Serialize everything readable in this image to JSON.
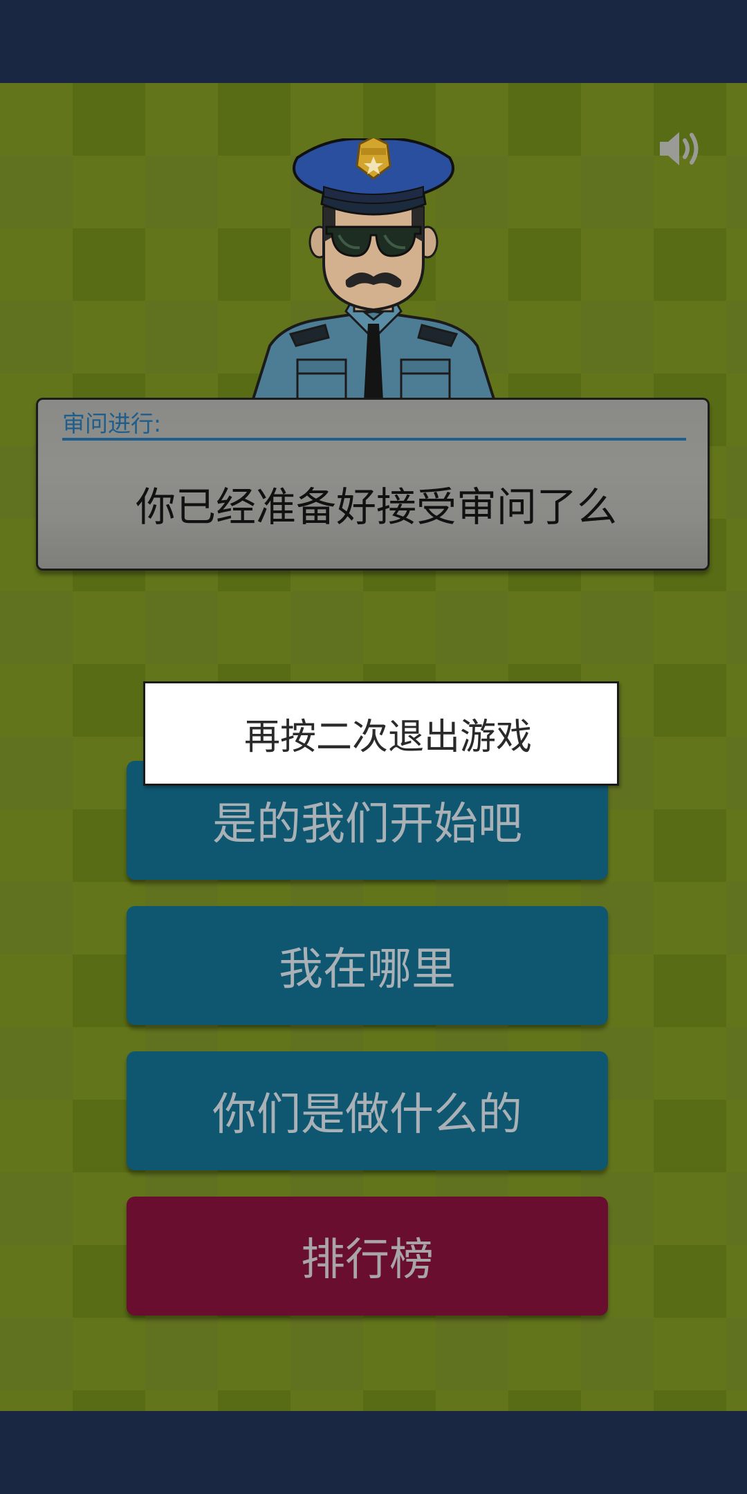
{
  "panel": {
    "label": "审问进行:",
    "question": "你已经准备好接受审问了么"
  },
  "buttons": [
    {
      "label": "是的我们开始吧"
    },
    {
      "label": "我在哪里"
    },
    {
      "label": "你们是做什么的"
    },
    {
      "label": "排行榜"
    }
  ],
  "toast": {
    "message": "再按二次退出游戏"
  },
  "icons": {
    "sound": "speaker-volume-icon",
    "character": "police-officer-icon"
  },
  "colors": {
    "background": "#5e7216",
    "system_bars": "#1a2742",
    "button_blue": "#0f5670",
    "button_red": "#6a0e2f",
    "panel_accent": "#1e5d8c"
  }
}
